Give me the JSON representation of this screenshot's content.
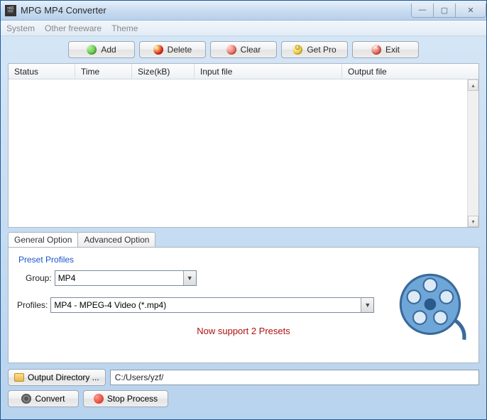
{
  "window": {
    "title": "MPG MP4 Converter"
  },
  "menu": {
    "system": "System",
    "other": "Other freeware",
    "theme": "Theme"
  },
  "toolbar": {
    "add": "Add",
    "delete": "Delete",
    "clear": "Clear",
    "getpro": "Get Pro",
    "exit": "Exit"
  },
  "table": {
    "headers": {
      "status": "Status",
      "time": "Time",
      "size": "Size(kB)",
      "input": "Input file",
      "output": "Output file"
    },
    "rows": []
  },
  "tabs": {
    "general": "General Option",
    "advanced": "Advanced Option"
  },
  "preset": {
    "section_label": "Preset Profiles",
    "group_label": "Group:",
    "group_value": "MP4",
    "profiles_label": "Profiles:",
    "profiles_value": "MP4 - MPEG-4 Video (*.mp4)",
    "support_text": "Now support 2 Presets"
  },
  "output": {
    "button": "Output Directory ...",
    "path": "C:/Users/yzf/"
  },
  "actions": {
    "convert": "Convert",
    "stop": "Stop Process"
  }
}
